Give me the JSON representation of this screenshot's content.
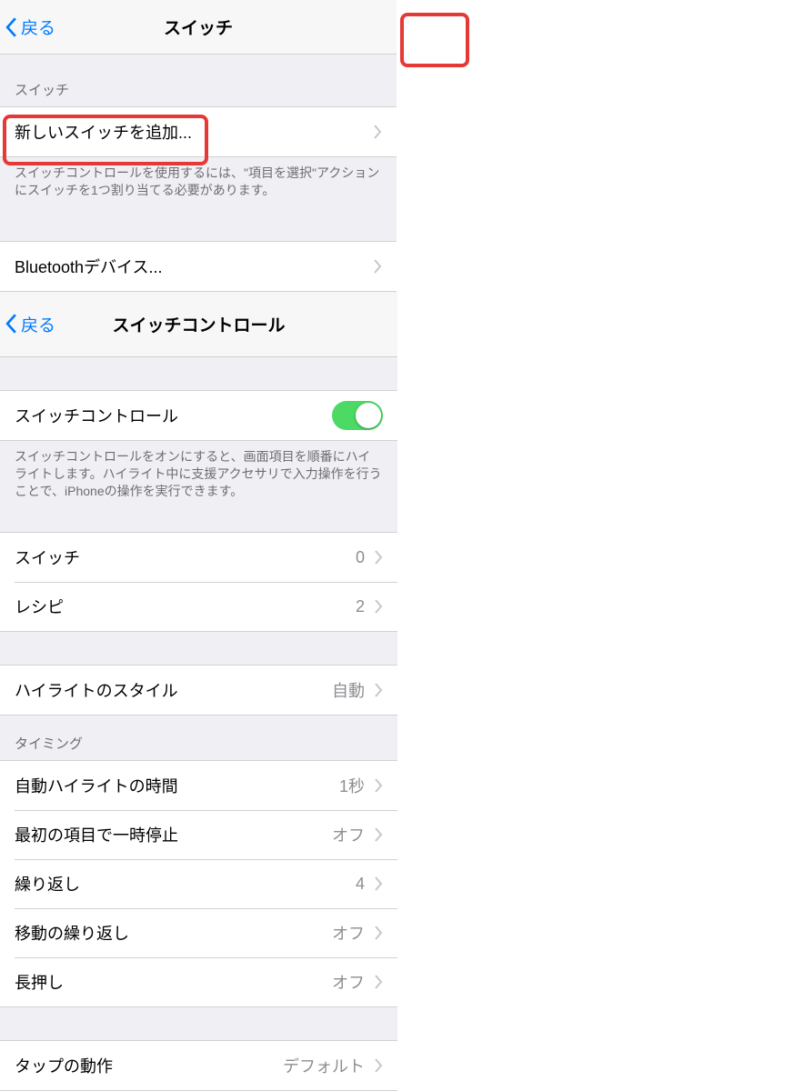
{
  "left": {
    "back": "戻る",
    "title": "スイッチ",
    "section1_header": "スイッチ",
    "add_switch": "新しいスイッチを追加...",
    "footer1": "スイッチコントロールを使用するには、\"項目を選択\"アクションにスイッチを1つ割り当てる必要があります。",
    "bluetooth": "Bluetoothデバイス..."
  },
  "right": {
    "back": "戻る",
    "title": "スイッチコントロール",
    "toggle_label": "スイッチコントロール",
    "toggle_on": true,
    "footer1": "スイッチコントロールをオンにすると、画面項目を順番にハイライトします。ハイライト中に支援アクセサリで入力操作を行うことで、iPhoneの操作を実行できます。",
    "switches_label": "スイッチ",
    "switches_value": "0",
    "recipes_label": "レシピ",
    "recipes_value": "2",
    "highlight_style_label": "ハイライトのスタイル",
    "highlight_style_value": "自動",
    "timing_header": "タイミング",
    "auto_highlight_label": "自動ハイライトの時間",
    "auto_highlight_value": "1秒",
    "pause_first_label": "最初の項目で一時停止",
    "pause_first_value": "オフ",
    "repeat_label": "繰り返し",
    "repeat_value": "4",
    "move_repeat_label": "移動の繰り返し",
    "move_repeat_value": "オフ",
    "long_press_label": "長押し",
    "long_press_value": "オフ",
    "tap_behavior_label": "タップの動作",
    "tap_behavior_value": "デフォルト"
  }
}
